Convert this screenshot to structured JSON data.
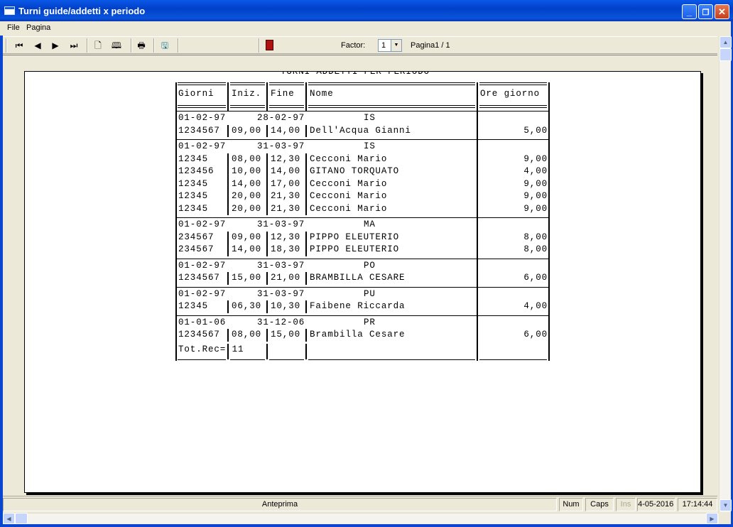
{
  "window": {
    "title": "Turni guide/addetti x periodo"
  },
  "menu": [
    "File",
    "Pagina"
  ],
  "toolbar": {
    "factor_label": "Factor:",
    "factor_value": "1",
    "page_label": "Pagina1 / 1",
    "icons": [
      "first-page-icon",
      "prev-page-icon",
      "next-page-icon",
      "last-page-icon",
      "single-page-icon",
      "two-pages-icon",
      "print-icon",
      "export-icon",
      "exit-door-icon"
    ]
  },
  "report": {
    "title": "TURNI ADDETTI PER PERIODO",
    "headers": {
      "giorni": "Giorni",
      "iniz": "Iniz.",
      "fine": "Fine",
      "nome": "Nome",
      "ore": "Ore giorno"
    },
    "groups": [
      {
        "from": "01-02-97",
        "to": "28-02-97",
        "code": "IS",
        "rows": [
          {
            "id": "1234567",
            "iniz": "09,00",
            "fine": "14,00",
            "nome": "Dell'Acqua Gianni",
            "ore": "5,00"
          }
        ]
      },
      {
        "from": "01-02-97",
        "to": "31-03-97",
        "code": "IS",
        "rows": [
          {
            "id": "12345",
            "iniz": "08,00",
            "fine": "12,30",
            "nome": "Cecconi Mario",
            "ore": "9,00"
          },
          {
            "id": "123456",
            "iniz": "10,00",
            "fine": "14,00",
            "nome": "GITANO TORQUATO",
            "ore": "4,00"
          },
          {
            "id": "12345",
            "iniz": "14,00",
            "fine": "17,00",
            "nome": "Cecconi Mario",
            "ore": "9,00"
          },
          {
            "id": "12345",
            "iniz": "20,00",
            "fine": "21,30",
            "nome": "Cecconi Mario",
            "ore": "9,00"
          },
          {
            "id": "12345",
            "iniz": "20,00",
            "fine": "21,30",
            "nome": "Cecconi Mario",
            "ore": "9,00"
          }
        ]
      },
      {
        "from": "01-02-97",
        "to": "31-03-97",
        "code": "MA",
        "rows": [
          {
            "id": "234567",
            "iniz": "09,00",
            "fine": "12,30",
            "nome": "PIPPO ELEUTERIO",
            "ore": "8,00"
          },
          {
            "id": "234567",
            "iniz": "14,00",
            "fine": "18,30",
            "nome": "PIPPO ELEUTERIO",
            "ore": "8,00"
          }
        ]
      },
      {
        "from": "01-02-97",
        "to": "31-03-97",
        "code": "PO",
        "rows": [
          {
            "id": "1234567",
            "iniz": "15,00",
            "fine": "21,00",
            "nome": "BRAMBILLA CESARE",
            "ore": "6,00"
          }
        ]
      },
      {
        "from": "01-02-97",
        "to": "31-03-97",
        "code": "PU",
        "rows": [
          {
            "id": "12345",
            "iniz": "06,30",
            "fine": "10,30",
            "nome": "Faibene Riccarda",
            "ore": "4,00"
          }
        ]
      },
      {
        "from": "01-01-06",
        "to": "31-12-06",
        "code": "PR",
        "rows": [
          {
            "id": "1234567",
            "iniz": "08,00",
            "fine": "15,00",
            "nome": "Brambilla Cesare",
            "ore": "6,00"
          }
        ]
      }
    ],
    "total": "Tot.Rec= 11"
  },
  "status": {
    "mode": "Anteprima",
    "num": "Num",
    "caps": "Caps",
    "ins": "Ins",
    "date": "04-05-2016",
    "time": "17:14:44"
  }
}
